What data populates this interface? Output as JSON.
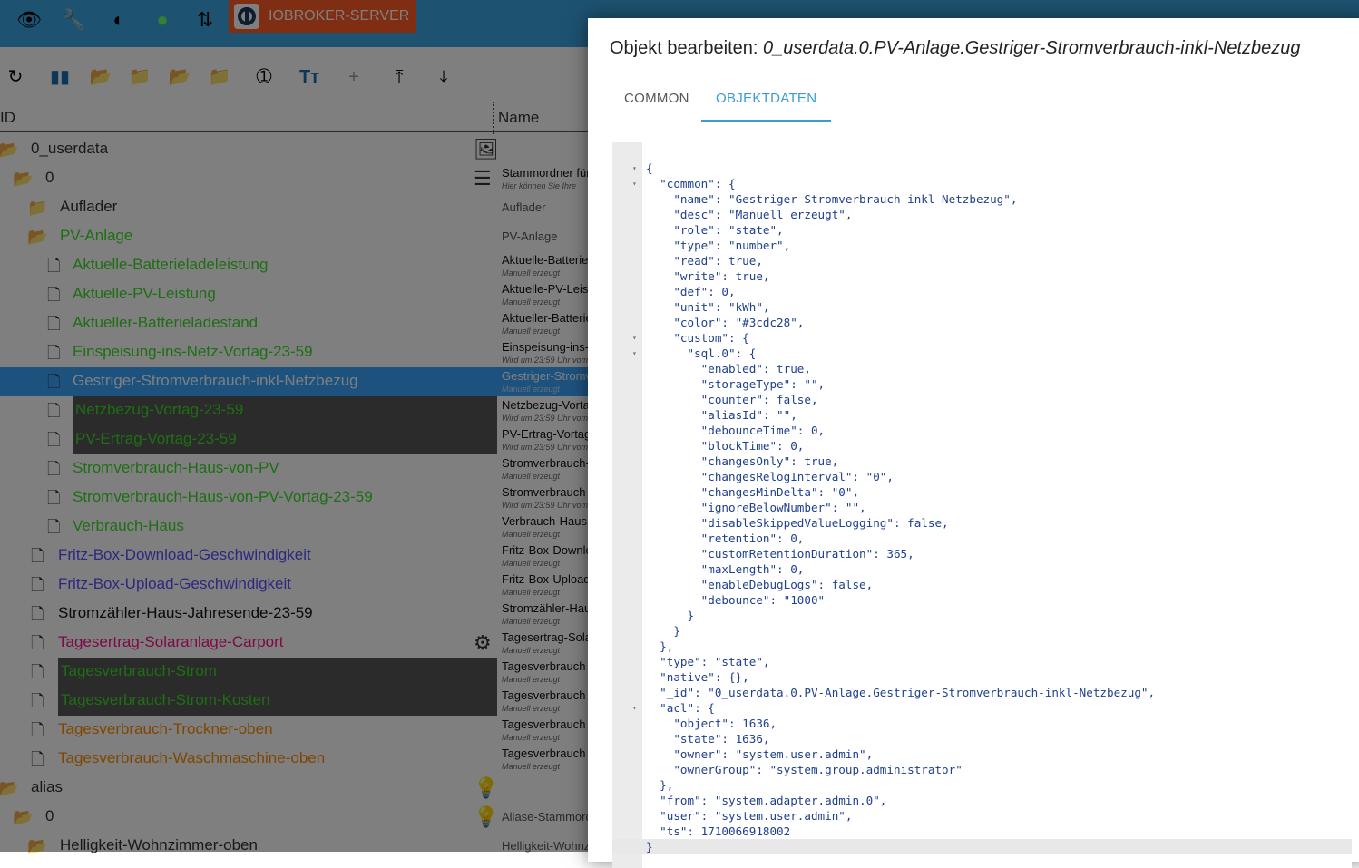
{
  "topbar": {
    "icons": [
      "eye-icon",
      "wrench-icon",
      "brightness-icon",
      "expert-mode-icon",
      "sync-disabled-icon"
    ],
    "server_label": "IOBROKER-SERVER",
    "color": "#3aa4e0",
    "server_color": "#ff5a26"
  },
  "toolbar": {
    "icons": [
      "refresh-icon",
      "columns-icon",
      "folder-open-icon",
      "folder-icon",
      "folder-open-blue-icon",
      "folder-blue-icon",
      "counter-1-icon",
      "text-size-icon",
      "add-icon",
      "upload-icon",
      "download-icon"
    ]
  },
  "columns": {
    "id": "ID",
    "name": "Name"
  },
  "tree": [
    {
      "label": "0_userdata",
      "level": 0,
      "icon": "folder-open",
      "color": "#333333",
      "right_icon": "image-icon"
    },
    {
      "label": "0",
      "level": 1,
      "icon": "folder-open",
      "color": "#333333",
      "right_icon": "doc-icon",
      "name": "Stammordner für",
      "desc": "Hier können Sie Ihre"
    },
    {
      "label": "Auflader",
      "level": 2,
      "icon": "folder",
      "color": "#333333",
      "name": "Auflader"
    },
    {
      "label": "PV-Anlage",
      "level": 2,
      "icon": "folder-open",
      "color": "#3cdc28",
      "name": "PV-Anlage"
    },
    {
      "label": "Aktuelle-Batterieladeleistung",
      "level": 3,
      "icon": "file",
      "color": "#3cdc28",
      "name": "Aktuelle-Batterieladeleistung",
      "desc": "Manuell erzeugt"
    },
    {
      "label": "Aktuelle-PV-Leistung",
      "level": 3,
      "icon": "file",
      "color": "#3cdc28",
      "name": "Aktuelle-PV-Leistung",
      "desc": "Manuell erzeugt"
    },
    {
      "label": "Aktueller-Batterieladestand",
      "level": 3,
      "icon": "file",
      "color": "#3cdc28",
      "name": "Aktueller-Batterieladestand",
      "desc": "Manuell erzeugt"
    },
    {
      "label": "Einspeisung-ins-Netz-Vortag-23-59",
      "level": 3,
      "icon": "file",
      "color": "#3cdc28",
      "name": "Einspeisung-ins-Netz",
      "desc": "Wird um 23:59 Uhr vom"
    },
    {
      "label": "Gestriger-Stromverbrauch-inkl-Netzbezug",
      "level": 3,
      "icon": "file",
      "color": "#ffffff",
      "selected": true,
      "name": "Gestriger-Stromverbrauch",
      "desc": "Manuell erzeugt"
    },
    {
      "label": "Netzbezug-Vortag-23-59",
      "level": 3,
      "icon": "file",
      "color": "#3cdc28",
      "boxed": true,
      "name": "Netzbezug-Vortag",
      "desc": "Wird um 23:59 Uhr vom"
    },
    {
      "label": "PV-Ertrag-Vortag-23-59",
      "level": 3,
      "icon": "file",
      "color": "#3cdc28",
      "boxed": true,
      "name": "PV-Ertrag-Vortag",
      "desc": "Wird um 23:59 Uhr vom"
    },
    {
      "label": "Stromverbrauch-Haus-von-PV",
      "level": 3,
      "icon": "file",
      "color": "#3cdc28",
      "name": "Stromverbrauch-Haus",
      "desc": "Manuell erzeugt"
    },
    {
      "label": "Stromverbrauch-Haus-von-PV-Vortag-23-59",
      "level": 3,
      "icon": "file",
      "color": "#3cdc28",
      "name": "Stromverbrauch-Haus",
      "desc": "Wird um 23:59 Uhr vom"
    },
    {
      "label": "Verbrauch-Haus",
      "level": 3,
      "icon": "file",
      "color": "#3cdc28",
      "name": "Verbrauch-Haus",
      "desc": "Manuell erzeugt"
    },
    {
      "label": "Fritz-Box-Download-Geschwindigkeit",
      "level": 2,
      "icon": "file",
      "color": "#5a50ff",
      "name": "Fritz-Box-Download",
      "desc": "Manuell erzeugt"
    },
    {
      "label": "Fritz-Box-Upload-Geschwindigkeit",
      "level": 2,
      "icon": "file",
      "color": "#5a50ff",
      "name": "Fritz-Box-Upload",
      "desc": "Manuell erzeugt"
    },
    {
      "label": "Stromzähler-Haus-Jahresende-23-59",
      "level": 2,
      "icon": "file",
      "color": "#111111",
      "name": "Stromzähler-Haus",
      "desc": "Manuell erzeugt"
    },
    {
      "label": "Tagesertrag-Solaranlage-Carport",
      "level": 2,
      "icon": "file",
      "color": "#ff1090",
      "right_icon": "settings-icon",
      "name": "Tagesertrag-Solaranlage",
      "desc": "Manuell erzeugt"
    },
    {
      "label": "Tagesverbrauch-Strom",
      "level": 2,
      "icon": "file",
      "color": "#3cdc28",
      "boxed2": true,
      "name": "Tagesverbrauch",
      "desc": "Manuell erzeugt"
    },
    {
      "label": "Tagesverbrauch-Strom-Kosten",
      "level": 2,
      "icon": "file",
      "color": "#3cdc28",
      "boxed2": true,
      "name": "Tagesverbrauch",
      "desc": "Manuell erzeugt"
    },
    {
      "label": "Tagesverbrauch-Trockner-oben",
      "level": 2,
      "icon": "file",
      "color": "#ff8c00",
      "name": "Tagesverbrauch",
      "desc": "Manuell erzeugt"
    },
    {
      "label": "Tagesverbrauch-Waschmaschine-oben",
      "level": 2,
      "icon": "file",
      "color": "#ff8c00",
      "name": "Tagesverbrauch",
      "desc": "Manuell erzeugt"
    },
    {
      "label": "alias",
      "level": 0,
      "icon": "folder-open",
      "color": "#333333",
      "right_icon": "bulb-icon"
    },
    {
      "label": "0",
      "level": 1,
      "icon": "folder-open",
      "color": "#333333",
      "right_icon": "bulb-icon",
      "name": "Aliase-Stammordner"
    },
    {
      "label": "Helligkeit-Wohnzimmer-oben",
      "level": 2,
      "icon": "folder-open",
      "color": "#333333",
      "name": "Helligkeit-Wohnzimmer"
    }
  ],
  "dialog": {
    "title_prefix": "Objekt bearbeiten:",
    "title_id": "0_userdata.0.PV-Anlage.Gestriger-Stromverbrauch-inkl-Netzbezug",
    "tabs": [
      {
        "label": "COMMON",
        "active": false
      },
      {
        "label": "OBJEKTDATEN",
        "active": true
      }
    ],
    "accent": "#3a9cd0",
    "json_lines": [
      "{",
      "  \"common\": {",
      "    \"name\": \"Gestriger-Stromverbrauch-inkl-Netzbezug\",",
      "    \"desc\": \"Manuell erzeugt\",",
      "    \"role\": \"state\",",
      "    \"type\": \"number\",",
      "    \"read\": true,",
      "    \"write\": true,",
      "    \"def\": 0,",
      "    \"unit\": \"kWh\",",
      "    \"color\": \"#3cdc28\",",
      "    \"custom\": {",
      "      \"sql.0\": {",
      "        \"enabled\": true,",
      "        \"storageType\": \"\",",
      "        \"counter\": false,",
      "        \"aliasId\": \"\",",
      "        \"debounceTime\": 0,",
      "        \"blockTime\": 0,",
      "        \"changesOnly\": true,",
      "        \"changesRelogInterval\": \"0\",",
      "        \"changesMinDelta\": \"0\",",
      "        \"ignoreBelowNumber\": \"\",",
      "        \"disableSkippedValueLogging\": false,",
      "        \"retention\": 0,",
      "        \"customRetentionDuration\": 365,",
      "        \"maxLength\": 0,",
      "        \"enableDebugLogs\": false,",
      "        \"debounce\": \"1000\"",
      "      }",
      "    }",
      "  },",
      "  \"type\": \"state\",",
      "  \"native\": {},",
      "  \"_id\": \"0_userdata.0.PV-Anlage.Gestriger-Stromverbrauch-inkl-Netzbezug\",",
      "  \"acl\": {",
      "    \"object\": 1636,",
      "    \"state\": 1636,",
      "    \"owner\": \"system.user.admin\",",
      "    \"ownerGroup\": \"system.group.administrator\"",
      "  },",
      "  \"from\": \"system.adapter.admin.0\",",
      "  \"user\": \"system.user.admin\",",
      "  \"ts\": 1710066918002",
      "}"
    ],
    "fold_lines": [
      0,
      1,
      11,
      12,
      35
    ],
    "active_line": 44
  }
}
